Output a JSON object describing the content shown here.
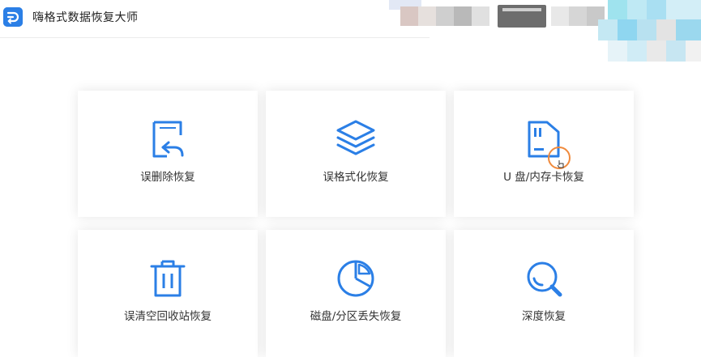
{
  "app": {
    "title": "嗨格式数据恢复大师",
    "accent_color": "#2b7fe6",
    "logo_icon": "app-logo-icon"
  },
  "cards": [
    {
      "label": "误删除恢复",
      "icon": "file-restore-icon"
    },
    {
      "label": "误格式化恢复",
      "icon": "layers-icon"
    },
    {
      "label": "U 盘/内存卡恢复",
      "icon": "sd-card-icon"
    },
    {
      "label": "误清空回收站恢复",
      "icon": "trash-icon"
    },
    {
      "label": "磁盘/分区丢失恢复",
      "icon": "pie-chart-icon"
    },
    {
      "label": "深度恢复",
      "icon": "deep-search-icon"
    }
  ]
}
